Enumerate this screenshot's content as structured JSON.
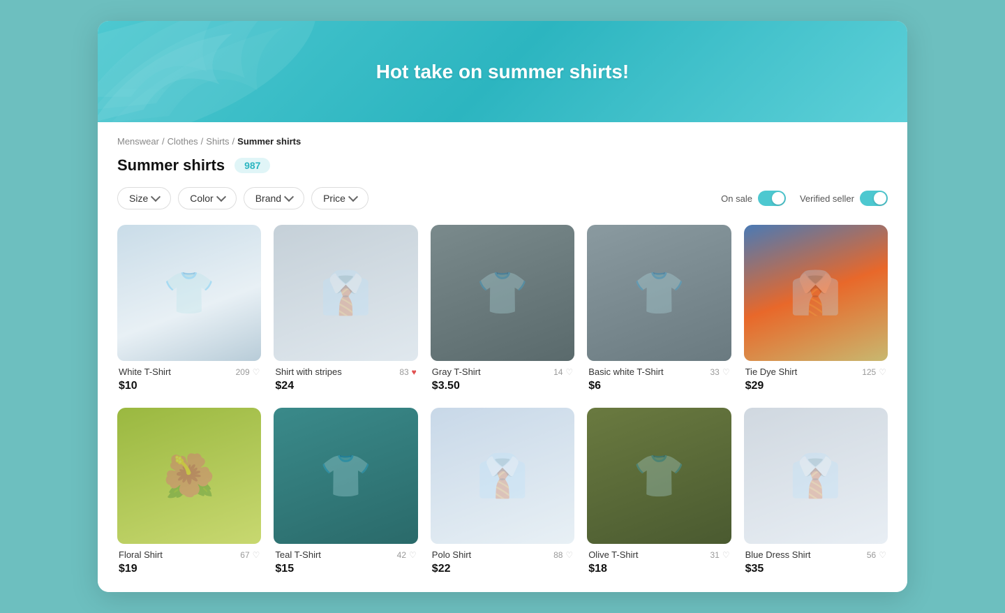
{
  "hero": {
    "title": "Hot take on summer shirts!"
  },
  "breadcrumb": {
    "items": [
      "Menswear",
      "Clothes",
      "Shirts"
    ],
    "active": "Summer shirts"
  },
  "page": {
    "title": "Summer shirts",
    "count": "987"
  },
  "filters": {
    "size_label": "Size",
    "color_label": "Color",
    "brand_label": "Brand",
    "price_label": "Price",
    "on_sale_label": "On sale",
    "verified_seller_label": "Verified seller"
  },
  "products": [
    {
      "id": 1,
      "name": "White T-Shirt",
      "price": "$10",
      "likes": 209,
      "heart": "outline",
      "img_class": "img-white-tshirt",
      "emoji": "👕"
    },
    {
      "id": 2,
      "name": "Shirt with stripes",
      "price": "$24",
      "likes": 83,
      "heart": "filled",
      "img_class": "img-stripes",
      "emoji": "👔"
    },
    {
      "id": 3,
      "name": "Gray T-Shirt",
      "price": "$3.50",
      "likes": 14,
      "heart": "outline",
      "img_class": "img-gray-tshirt",
      "emoji": "👕"
    },
    {
      "id": 4,
      "name": "Basic white T-Shirt",
      "price": "$6",
      "likes": 33,
      "heart": "outline",
      "img_class": "img-basic-white",
      "emoji": "👕"
    },
    {
      "id": 5,
      "name": "Tie Dye Shirt",
      "price": "$29",
      "likes": 125,
      "heart": "outline",
      "img_class": "img-tiedye",
      "emoji": "👔"
    },
    {
      "id": 6,
      "name": "Floral Shirt",
      "price": "$19",
      "likes": 67,
      "heart": "outline",
      "img_class": "img-floral",
      "emoji": "🌺"
    },
    {
      "id": 7,
      "name": "Teal T-Shirt",
      "price": "$15",
      "likes": 42,
      "heart": "outline",
      "img_class": "img-teal",
      "emoji": "👕"
    },
    {
      "id": 8,
      "name": "Polo Shirt",
      "price": "$22",
      "likes": 88,
      "heart": "outline",
      "img_class": "img-polo",
      "emoji": "👔"
    },
    {
      "id": 9,
      "name": "Olive T-Shirt",
      "price": "$18",
      "likes": 31,
      "heart": "outline",
      "img_class": "img-olive",
      "emoji": "👕"
    },
    {
      "id": 10,
      "name": "Blue Dress Shirt",
      "price": "$35",
      "likes": 56,
      "heart": "outline",
      "img_class": "img-blue-shirt",
      "emoji": "👔"
    }
  ]
}
